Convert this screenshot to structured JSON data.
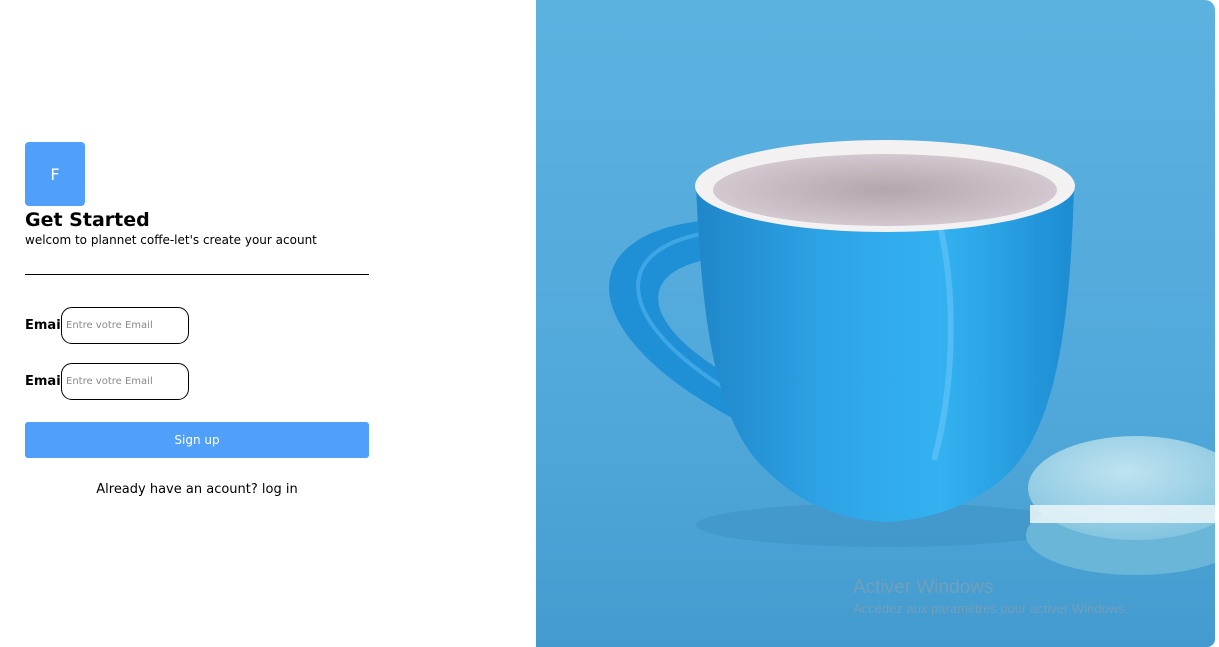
{
  "brand": {
    "logo_letter": "F",
    "accent_color": "#4f9ffb"
  },
  "header": {
    "title": "Get Started",
    "subtitle": "welcom to plannet coffe-let's create your acount"
  },
  "form": {
    "fields": [
      {
        "label": "Email",
        "placeholder": "Entre votre Email",
        "value": ""
      },
      {
        "label": "Email",
        "placeholder": "Entre votre Email",
        "value": ""
      }
    ],
    "submit_label": "Sign up",
    "login_prompt": "Already have an acount?",
    "login_link": "log in"
  },
  "hero_image": {
    "subject": "blue coffee cup with macaron on blue background",
    "background_color": "#56ade0"
  },
  "os_watermark": {
    "title": "Activer Windows",
    "subtitle": "Accédez aux paramètres pour activer Windows."
  }
}
